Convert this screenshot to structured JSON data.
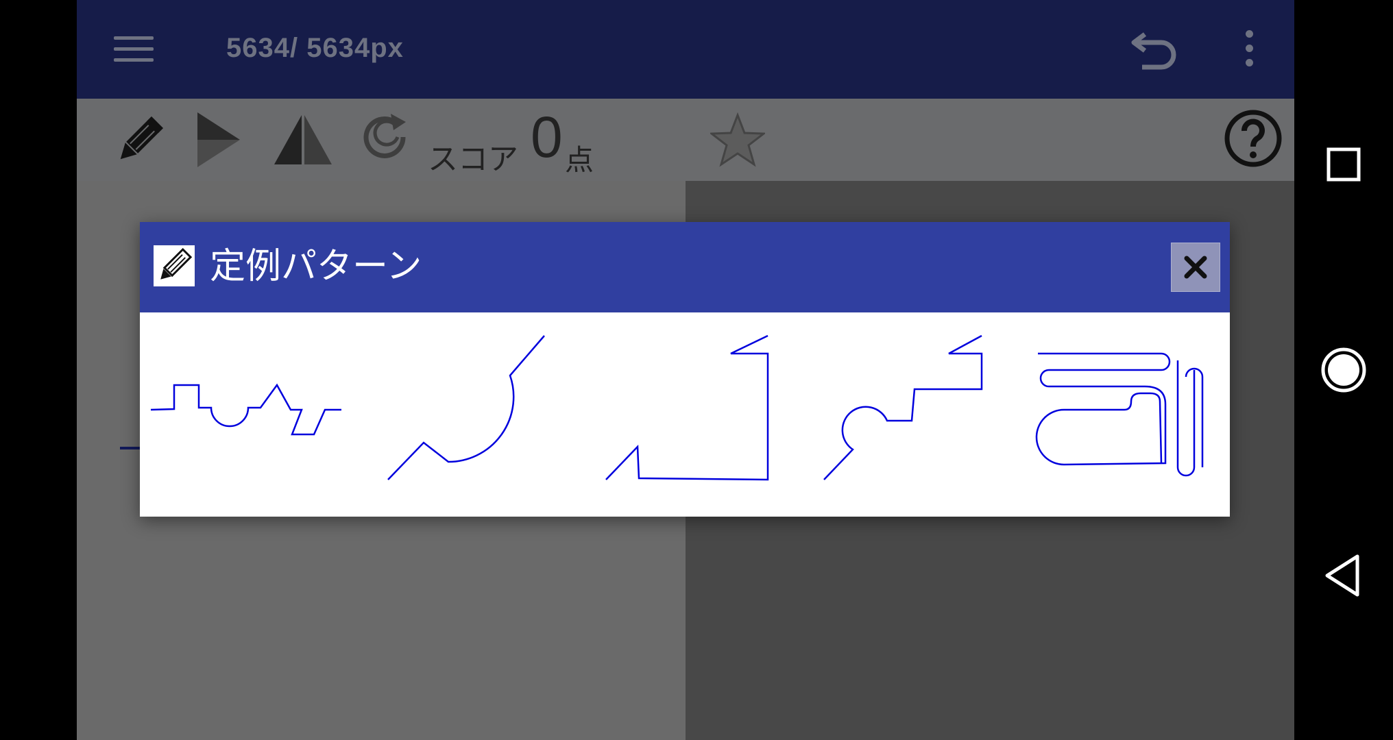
{
  "appbar": {
    "title": "5634/ 5634px",
    "icons": [
      "menu-icon",
      "undo-icon",
      "more-vert-icon"
    ]
  },
  "toolbar": {
    "score_label": "スコア",
    "score_value": "0",
    "score_unit": "点",
    "icons": [
      "pencil-icon",
      "play-icon",
      "mirror-icon",
      "replay-icon",
      "star-icon",
      "help-icon"
    ]
  },
  "dialog": {
    "title": "定例パターン",
    "close_label": "×",
    "pattern_color": "#0000dd",
    "patterns": [
      "pattern-1",
      "pattern-2",
      "pattern-3",
      "pattern-4",
      "pattern-5"
    ]
  },
  "navbar": {
    "icons": [
      "recents-square-icon",
      "home-circle-icon",
      "back-triangle-icon"
    ]
  },
  "colors": {
    "appbar": "#161c49",
    "dialog_header": "#303fa0",
    "toolbar": "#6a6b6d",
    "canvas_right": "#484848"
  }
}
